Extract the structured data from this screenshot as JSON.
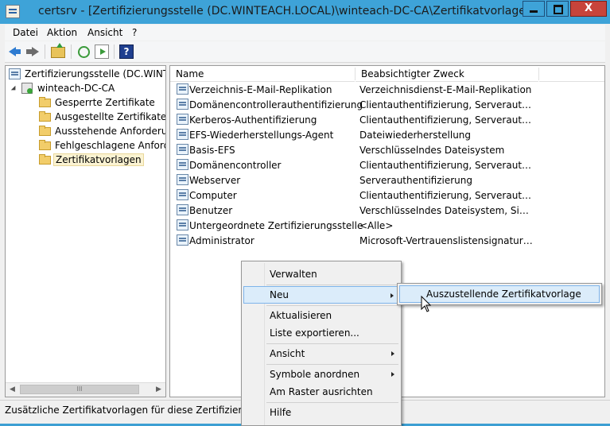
{
  "window": {
    "title": "certsrv - [Zertifizierungsstelle (DC.WINTEACH.LOCAL)\\winteach-DC-CA\\Zertifikatvorlagen]",
    "close_glyph": "X"
  },
  "menubar": {
    "items": [
      "Datei",
      "Aktion",
      "Ansicht",
      "?"
    ]
  },
  "toolbar": {
    "icons": [
      "back-arrow-icon",
      "forward-arrow-icon",
      "up-folder-icon",
      "refresh-icon",
      "export-list-icon",
      "help-icon"
    ],
    "help_glyph": "?"
  },
  "tree": {
    "root": "Zertifizierungsstelle (DC.WINTEACH.LOCAL)",
    "ca": "winteach-DC-CA",
    "items": [
      "Gesperrte Zertifikate",
      "Ausgestellte Zertifikate",
      "Ausstehende Anforderungen",
      "Fehlgeschlagene Anforderungen",
      "Zertifikatvorlagen"
    ],
    "selected": "Zertifikatvorlagen"
  },
  "hscroll": {
    "left": "◀",
    "right": "▶",
    "grip": "III"
  },
  "list": {
    "columns": [
      "Name",
      "Beabsichtigter Zweck"
    ],
    "rows": [
      {
        "name": "Verzeichnis-E-Mail-Replikation",
        "purpose": "Verzeichnisdienst-E-Mail-Replikation"
      },
      {
        "name": "Domänencontrollerauthentifizierung",
        "purpose": "Clientauthentifizierung, Serverauthentif..."
      },
      {
        "name": "Kerberos-Authentifizierung",
        "purpose": "Clientauthentifizierung, Serverauthentif..."
      },
      {
        "name": "EFS-Wiederherstellungs-Agent",
        "purpose": "Dateiwiederherstellung"
      },
      {
        "name": "Basis-EFS",
        "purpose": "Verschlüsselndes Dateisystem"
      },
      {
        "name": "Domänencontroller",
        "purpose": "Clientauthentifizierung, Serverauthentif..."
      },
      {
        "name": "Webserver",
        "purpose": "Serverauthentifizierung"
      },
      {
        "name": "Computer",
        "purpose": "Clientauthentifizierung, Serverauthentif..."
      },
      {
        "name": "Benutzer",
        "purpose": "Verschlüsselndes Dateisystem, Sichere E..."
      },
      {
        "name": "Untergeordnete Zertifizierungsstelle",
        "purpose": "<Alle>"
      },
      {
        "name": "Administrator",
        "purpose": "Microsoft-Vertrauenslistensignatur, Ver..."
      }
    ]
  },
  "context_menu": {
    "items": [
      "Verwalten",
      "Neu",
      "Aktualisieren",
      "Liste exportieren...",
      "Ansicht",
      "Symbole anordnen",
      "Am Raster ausrichten",
      "Hilfe"
    ],
    "highlighted": "Neu"
  },
  "submenu": {
    "items": [
      "Auszustellende Zertifikatvorlage"
    ]
  },
  "statusbar": {
    "text": "Zusätzliche Zertifikatvorlagen für diese Zertifizierungsstelle verwalten"
  }
}
